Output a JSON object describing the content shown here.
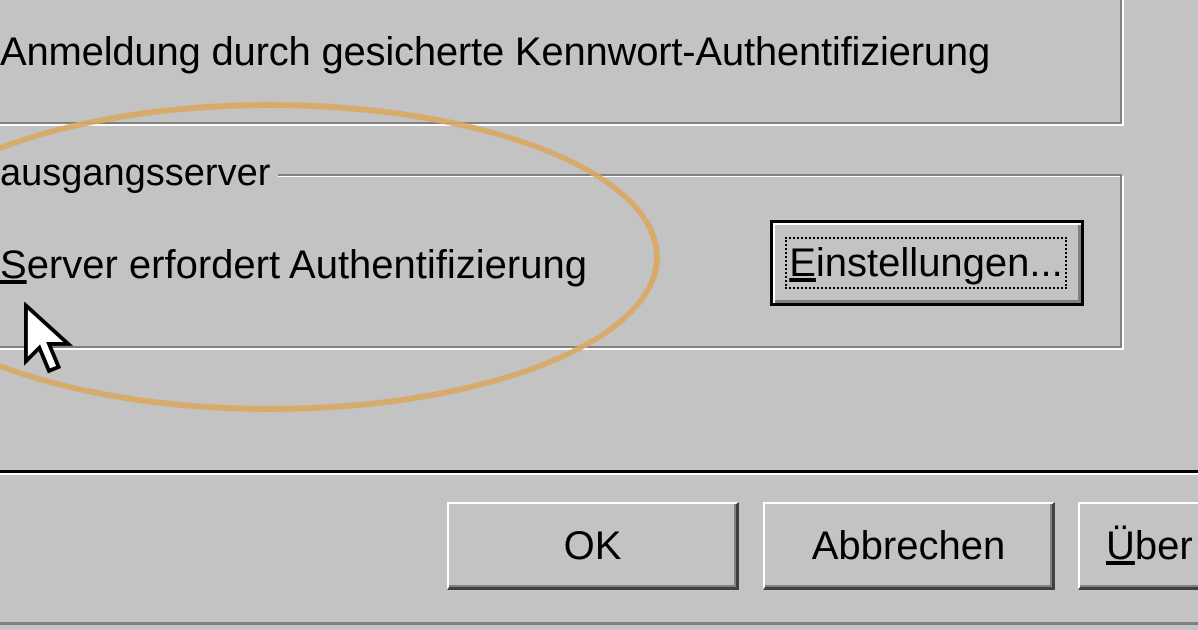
{
  "auth_group": {
    "spa_label": "Anmeldung durch gesicherte Kennwort-Authentifizierung"
  },
  "outgoing_group": {
    "title": "ausgangsserver",
    "server_auth_first": "S",
    "server_auth_rest": "erver erfordert Authentifizierung",
    "settings_first": "E",
    "settings_rest": "instellungen..."
  },
  "dialog_buttons": {
    "ok_label": "OK",
    "cancel_label": "Abbrechen",
    "apply_first": "Ü",
    "apply_rest": "ber"
  },
  "annotation": {
    "highlight_color": "#d9a863"
  },
  "icons": [
    "mouse-cursor-icon"
  ]
}
